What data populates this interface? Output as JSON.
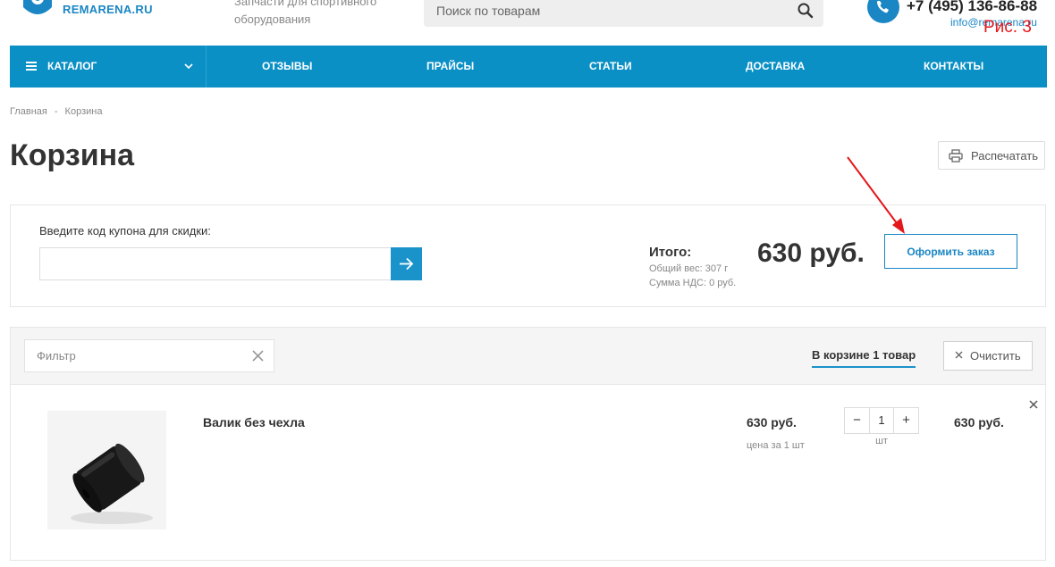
{
  "colors": {
    "accent": "#1a86c4",
    "nav_bg": "#0b90c6",
    "annotation": "#e4171b"
  },
  "header": {
    "logo_text": "REMARENA.RU",
    "tagline": "Запчасти для спортивного оборудования",
    "search_placeholder": "Поиск по товарам",
    "phone": "+7 (495) 136-86-88",
    "email": "info@remarena.ru",
    "figure_label": "Рис. 3"
  },
  "nav": {
    "catalog": "КАТАЛОГ",
    "items": [
      "ОТЗЫВЫ",
      "ПРАЙСЫ",
      "СТАТЬИ",
      "ДОСТАВКА",
      "КОНТАКТЫ"
    ]
  },
  "breadcrumb": {
    "home": "Главная",
    "separator": "-",
    "current": "Корзина"
  },
  "page": {
    "title": "Корзина",
    "print_label": "Распечатать"
  },
  "coupon": {
    "label": "Введите код купона для скидки:",
    "value": ""
  },
  "totals": {
    "label": "Итого:",
    "weight": "Общий вес: 307 г",
    "vat": "Сумма НДС: 0 руб.",
    "sum": "630 руб.",
    "checkout_label": "Оформить заказ"
  },
  "cart": {
    "filter_placeholder": "Фильтр",
    "count_label": "В корзине 1 товар",
    "clear_label": "Очистить",
    "items": [
      {
        "name": "Валик без чехла",
        "price": "630 руб.",
        "price_note": "цена за 1 шт",
        "quantity": "1",
        "unit": "шт",
        "total": "630 руб."
      }
    ]
  },
  "icons": {
    "logo": "logo-icon",
    "search": "search-icon",
    "phone": "phone-icon",
    "menu": "hamburger-icon",
    "chevron": "chevron-down-icon",
    "print": "printer-icon",
    "arrow": "arrow-right-icon",
    "close": "close-icon",
    "product": "product-image"
  }
}
